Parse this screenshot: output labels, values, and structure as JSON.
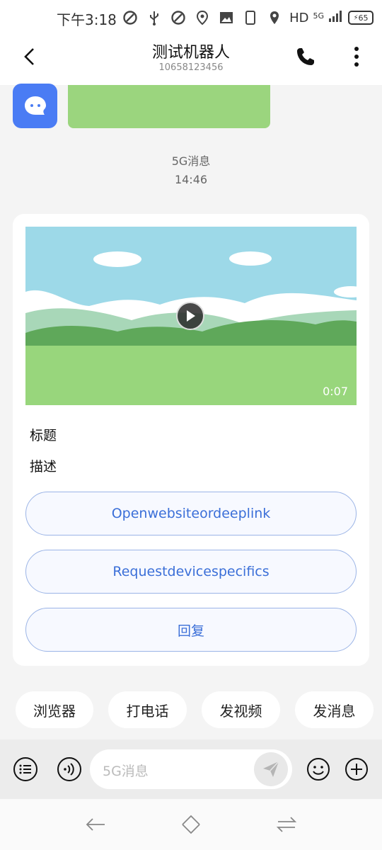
{
  "status_bar": {
    "time": "下午3:18",
    "hd": "HD",
    "network": "5G",
    "battery": "65",
    "icons": [
      "auto-sync-icon",
      "usb-icon",
      "auto-sync-icon",
      "location-icon",
      "image-icon",
      "phone-icon",
      "location-pin-icon"
    ]
  },
  "header": {
    "title": "测试机器人",
    "phone_number": "10658123456",
    "icons": [
      "back-arrow-icon",
      "phone-icon",
      "more-vertical-icon"
    ]
  },
  "message": {
    "label": "5G消息",
    "time": "14:46"
  },
  "card": {
    "video_duration": "0:07",
    "title": "标题",
    "description": "描述",
    "buttons": [
      {
        "label": "Openwebsiteordeeplink"
      },
      {
        "label": "Requestdevicespecifics"
      },
      {
        "label": "回复"
      }
    ]
  },
  "chips": [
    {
      "label": "浏览器"
    },
    {
      "label": "打电话"
    },
    {
      "label": "发视频"
    },
    {
      "label": "发消息"
    }
  ],
  "input": {
    "placeholder": "5G消息"
  },
  "colors": {
    "accent": "#3b6fd8",
    "avatar": "#4a7cf4",
    "green": "#9bd57e"
  }
}
